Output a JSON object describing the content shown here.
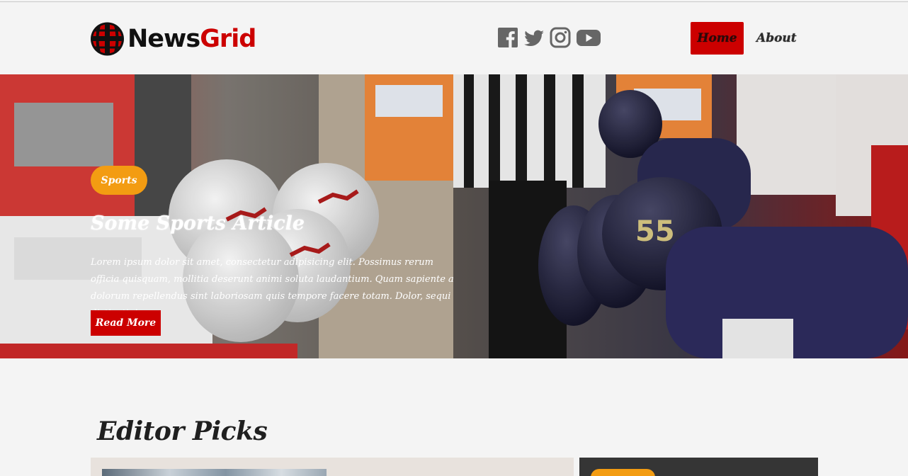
{
  "brand": {
    "name_part1": "News",
    "name_part2": "Grid",
    "colors": {
      "accent": "#cc0000",
      "tag": "#f39c12"
    }
  },
  "social": [
    {
      "icon": "facebook-icon"
    },
    {
      "icon": "twitter-icon"
    },
    {
      "icon": "instagram-icon"
    },
    {
      "icon": "youtube-icon"
    }
  ],
  "nav": {
    "items": [
      {
        "label": "Home",
        "active": true
      },
      {
        "label": "About",
        "active": false
      }
    ]
  },
  "hero": {
    "tag": "Sports",
    "title": "Some Sports Article",
    "excerpt": "Lorem ipsum dolor sit amet, consectetur adipisicing elit. Possimus rerum officia quisquam, mollitia deserunt animi soluta laudantium. Quam sapiente a dolorum repellendus sint laboriosam quis tempore facere totam. Dolor, sequi distinctio!",
    "cta": "Read More"
  },
  "editor_picks": {
    "title": "Editor Picks"
  }
}
